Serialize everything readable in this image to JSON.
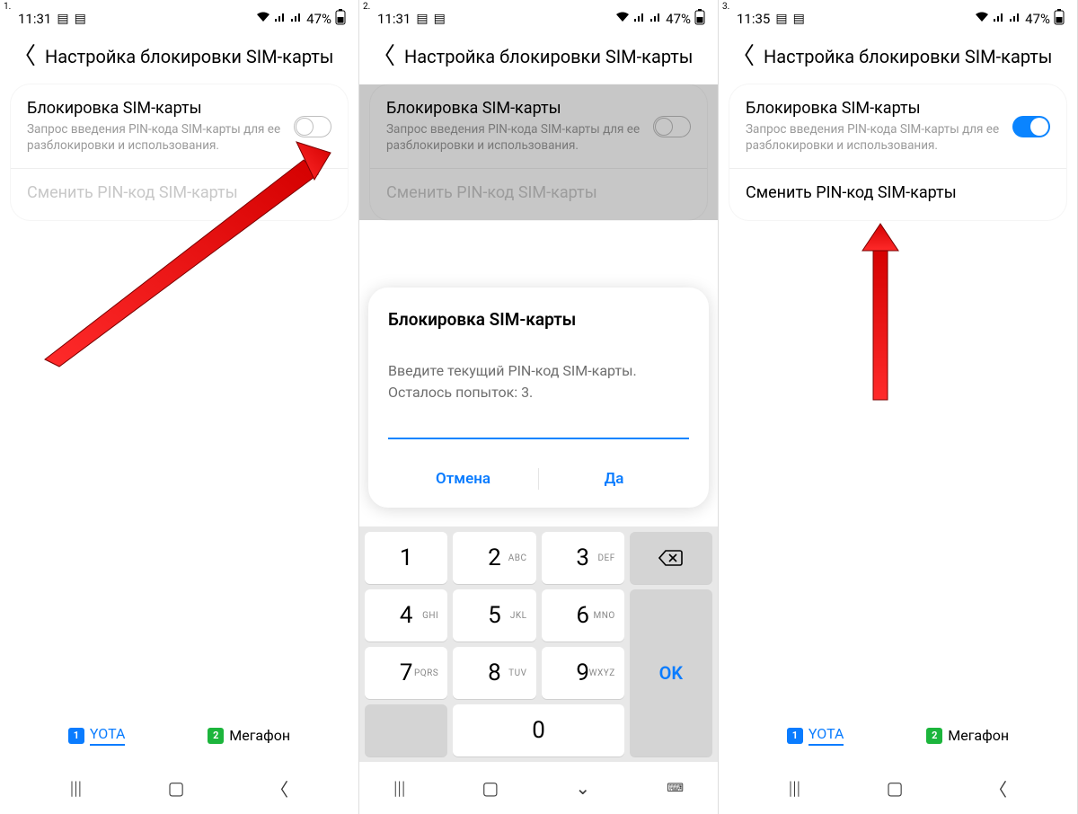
{
  "screens": [
    {
      "num": "1.",
      "time": "11:31",
      "battery": "47%"
    },
    {
      "num": "2.",
      "time": "11:31",
      "battery": "47%"
    },
    {
      "num": "3.",
      "time": "11:35",
      "battery": "47%"
    }
  ],
  "page_title": "Настройка блокировки SIM-карты",
  "lock_row": {
    "title": "Блокировка SIM-карты",
    "sub": "Запрос введения PIN-кода SIM-карты для ее разблокировки и использования."
  },
  "change_pin_label": "Сменить PIN-код SIM-карты",
  "dialog": {
    "title": "Блокировка SIM-карты",
    "msg_line1": "Введите текущий PIN-код SIM-карты.",
    "msg_line2": "Осталось попыток: 3.",
    "cancel": "Отмена",
    "ok": "Да"
  },
  "sim_tabs": {
    "sim1_badge": "1",
    "sim1_name": "YOTA",
    "sim2_badge": "2",
    "sim2_name": "Мегафон"
  },
  "keypad": {
    "keys": [
      {
        "d": "1",
        "s": ""
      },
      {
        "d": "2",
        "s": "ABC"
      },
      {
        "d": "3",
        "s": "DEF"
      },
      {
        "d": "4",
        "s": "GHI"
      },
      {
        "d": "5",
        "s": "JKL"
      },
      {
        "d": "6",
        "s": "MNO"
      },
      {
        "d": "7",
        "s": "PQRS"
      },
      {
        "d": "8",
        "s": "TUV"
      },
      {
        "d": "9",
        "s": "WXYZ"
      },
      {
        "d": "0",
        "s": ""
      }
    ],
    "ok": "OK"
  }
}
